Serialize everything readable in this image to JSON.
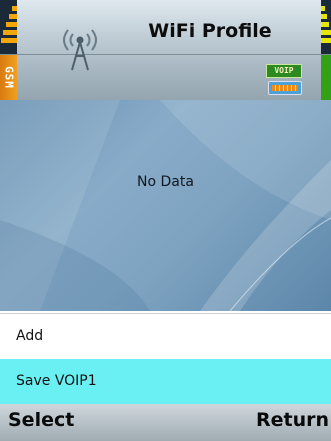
{
  "header": {
    "title": "WiFi Profile",
    "network_tab": "GSM",
    "voip_badge": "VOIP",
    "wifi_icon": "wifi-antenna-icon",
    "battery_icon": "battery-icon",
    "accent_left": "#f2a60c",
    "accent_right": "#34a015"
  },
  "main": {
    "empty_text": "No Data"
  },
  "menu": {
    "items": [
      {
        "label": "Add",
        "selected": false
      },
      {
        "label": "Save VOIP1",
        "selected": true
      }
    ],
    "highlight_color": "#6af0f2"
  },
  "softkeys": {
    "left": "Select",
    "right": "Return"
  }
}
